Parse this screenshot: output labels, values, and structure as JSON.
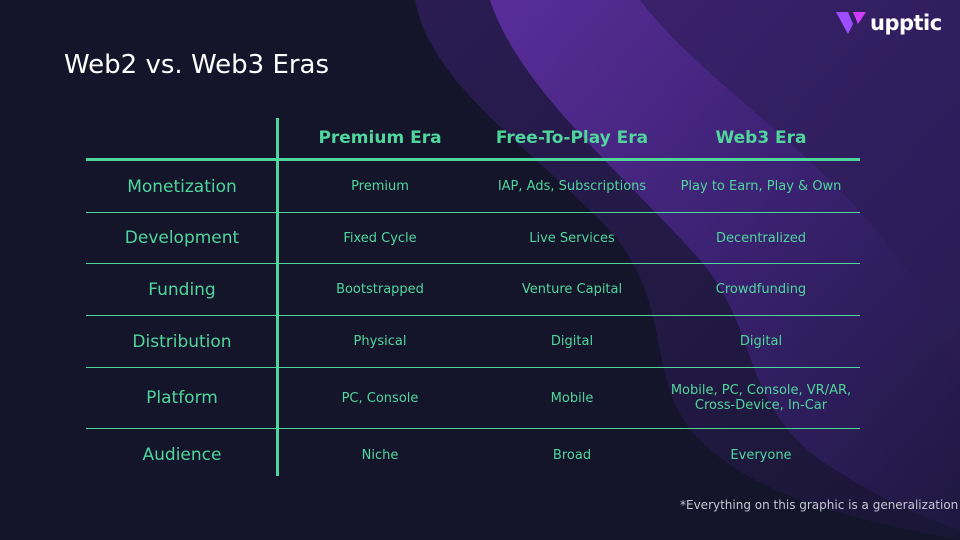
{
  "logo": {
    "text": "upptic"
  },
  "title": "Web2 vs. Web3 Eras",
  "table": {
    "headers": [
      "",
      "Premium Era",
      "Free-To-Play Era",
      "Web3 Era"
    ],
    "rows": [
      {
        "label": "Monetization",
        "cells": [
          "Premium",
          "IAP, Ads, Subscriptions",
          "Play to Earn, Play & Own"
        ]
      },
      {
        "label": "Development",
        "cells": [
          "Fixed Cycle",
          "Live Services",
          "Decentralized"
        ]
      },
      {
        "label": "Funding",
        "cells": [
          "Bootstrapped",
          "Venture Capital",
          "Crowdfunding"
        ]
      },
      {
        "label": "Distribution",
        "cells": [
          "Physical",
          "Digital",
          "Digital"
        ]
      },
      {
        "label": "Platform",
        "cells": [
          "PC, Console",
          "Mobile",
          "Mobile, PC, Console, VR/AR, Cross-Device, In-Car"
        ]
      },
      {
        "label": "Audience",
        "cells": [
          "Niche",
          "Broad",
          "Everyone"
        ]
      }
    ]
  },
  "footnote": "*Everything on this graphic is a generalization",
  "colors": {
    "accent": "#4fd69c",
    "background": "#14152b",
    "purple": "#4a2a80"
  }
}
